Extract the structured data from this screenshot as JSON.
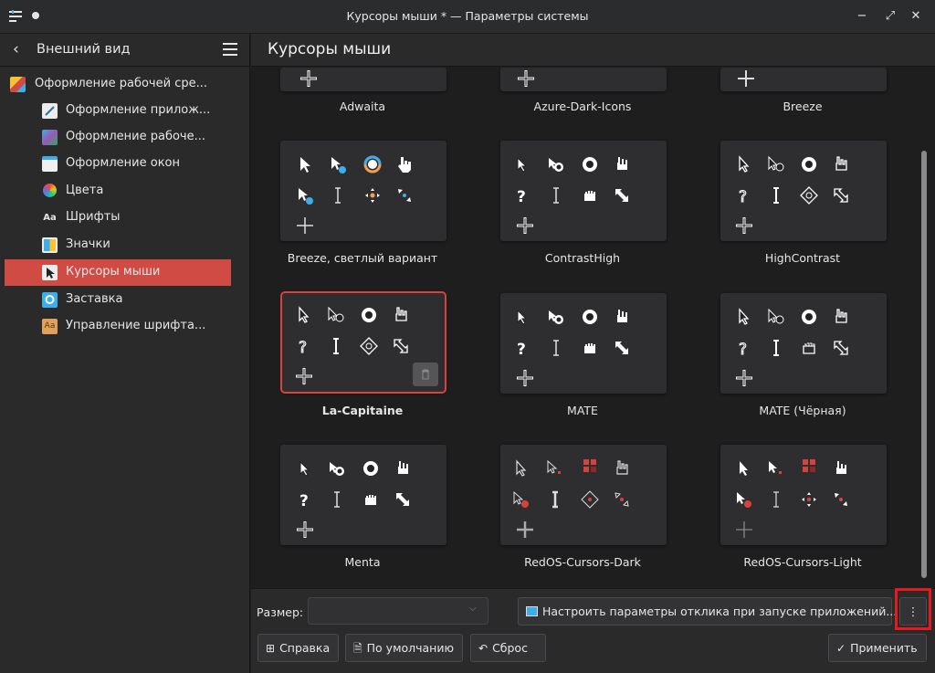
{
  "window": {
    "title": "Курсоры мыши * — Параметры системы",
    "buttons": {
      "minimize": "−",
      "maximize": "⤢",
      "close": "✕"
    }
  },
  "sidebar": {
    "back_label": "Внешний вид",
    "items": [
      {
        "label": "Оформление рабочей сре...",
        "icon": "workspace-theme-icon",
        "level": 0
      },
      {
        "label": "Оформление прилож...",
        "icon": "app-style-icon",
        "level": 1
      },
      {
        "label": "Оформление рабоче...",
        "icon": "plasma-style-icon",
        "level": 1
      },
      {
        "label": "Оформление окон",
        "icon": "window-decoration-icon",
        "level": 1
      },
      {
        "label": "Цвета",
        "icon": "colors-icon",
        "level": 1
      },
      {
        "label": "Шрифты",
        "icon": "fonts-icon",
        "level": 1
      },
      {
        "label": "Значки",
        "icon": "icons-icon",
        "level": 1
      },
      {
        "label": "Курсоры мыши",
        "icon": "cursor-icon",
        "level": 1,
        "active": true
      },
      {
        "label": "Заставка",
        "icon": "splash-icon",
        "level": 1
      },
      {
        "label": "Управление шрифта...",
        "icon": "font-management-icon",
        "level": 1
      }
    ]
  },
  "main": {
    "title": "Курсоры мыши",
    "themes": [
      {
        "name": "Adwaita"
      },
      {
        "name": "Azure-Dark-Icons"
      },
      {
        "name": "Breeze"
      },
      {
        "name": "Breeze, светлый вариант"
      },
      {
        "name": "ContrastHigh"
      },
      {
        "name": "HighContrast"
      },
      {
        "name": "La-Capitaine",
        "selected": true
      },
      {
        "name": "MATE"
      },
      {
        "name": "MATE (Чёрная)"
      },
      {
        "name": "Menta"
      },
      {
        "name": "RedOS-Cursors-Dark"
      },
      {
        "name": "RedOS-Cursors-Light"
      }
    ]
  },
  "bottom": {
    "size_label": "Размер:",
    "size_value": "",
    "launch_feedback_label": "Настроить параметры отклика при запуске приложений...",
    "more_label": "⋮",
    "help_label": "Справка",
    "defaults_label": "По умолчанию",
    "reset_label": "Сброс",
    "apply_label": "Применить"
  },
  "colors": {
    "accent": "#d14b45",
    "highlight_box": "#e5191f",
    "background": "#1e1e1f",
    "card": "#2e2e30"
  }
}
